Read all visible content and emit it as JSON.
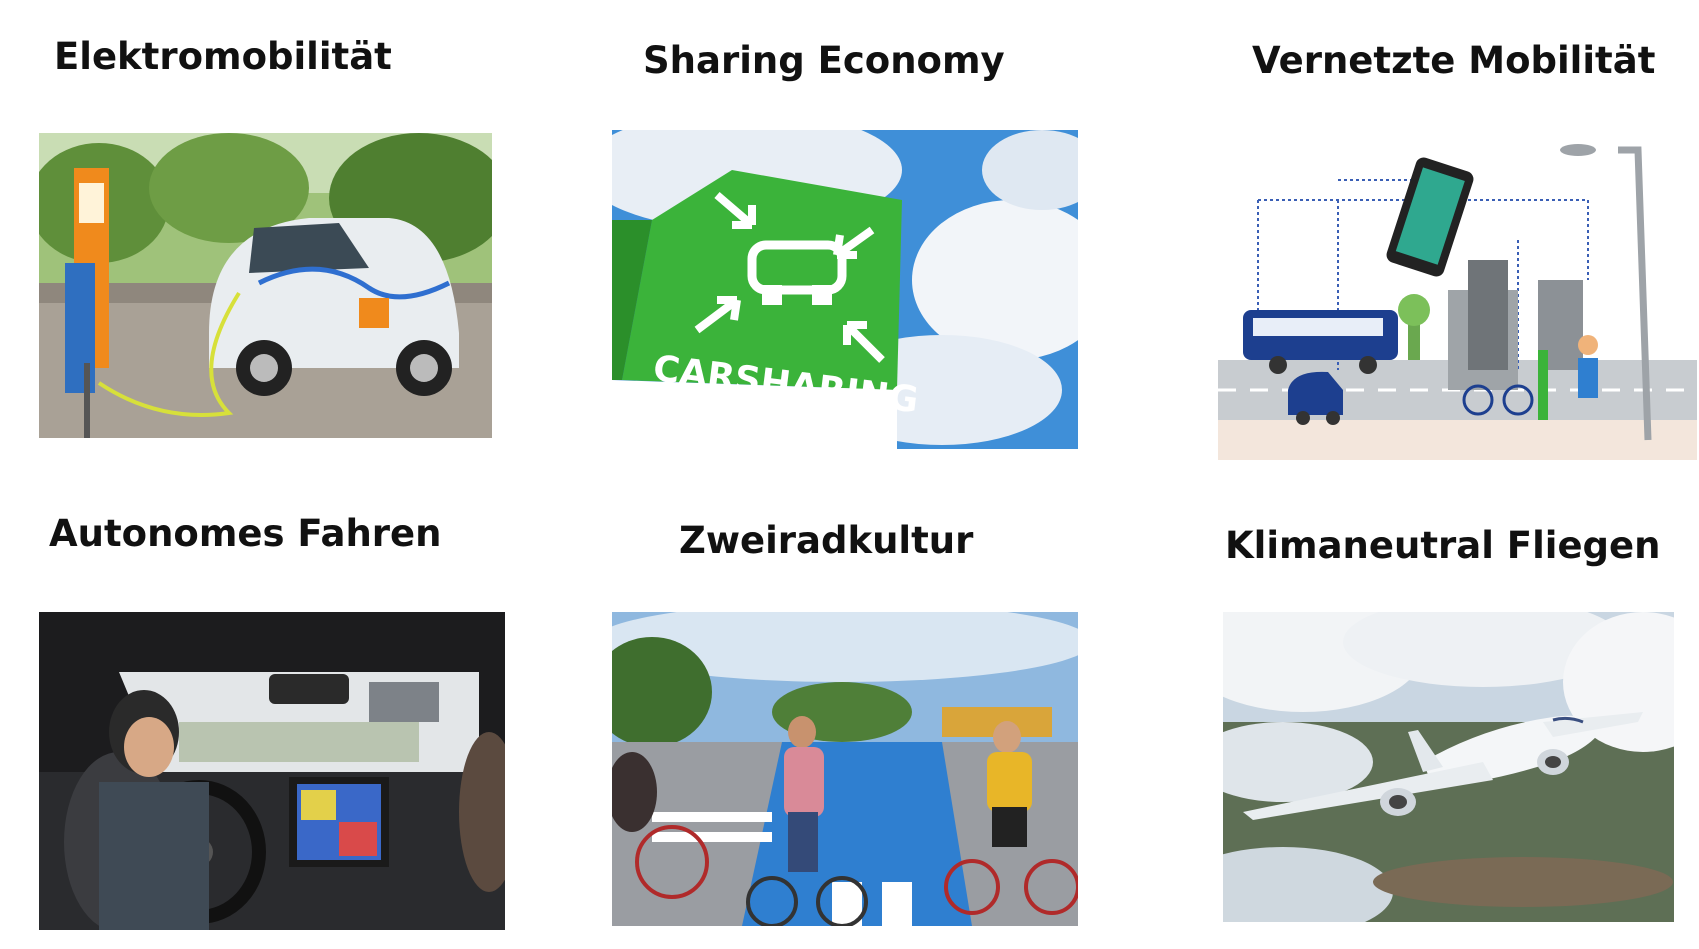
{
  "tiles": [
    {
      "title": "Elektromobilität",
      "image": "electric-car-charging-photo"
    },
    {
      "title": "Sharing Economy",
      "image": "carsharing-sign-photo",
      "sign_text": "CARSHARING"
    },
    {
      "title": "Vernetzte Mobilität",
      "image": "connected-mobility-illustration"
    },
    {
      "title": "Autonomes Fahren",
      "image": "autonomous-car-interior-photo"
    },
    {
      "title": "Zweiradkultur",
      "image": "cyclists-street-photo"
    },
    {
      "title": "Klimaneutral Fliegen",
      "image": "airplane-above-clouds-photo"
    }
  ],
  "colors": {
    "carsharing_green": "#3bb33a",
    "sky_blue": "#3f8fd8",
    "bus_blue": "#1d3f8f",
    "charger_orange": "#f08a1c",
    "bike_lane_blue": "#2f7fd0"
  }
}
